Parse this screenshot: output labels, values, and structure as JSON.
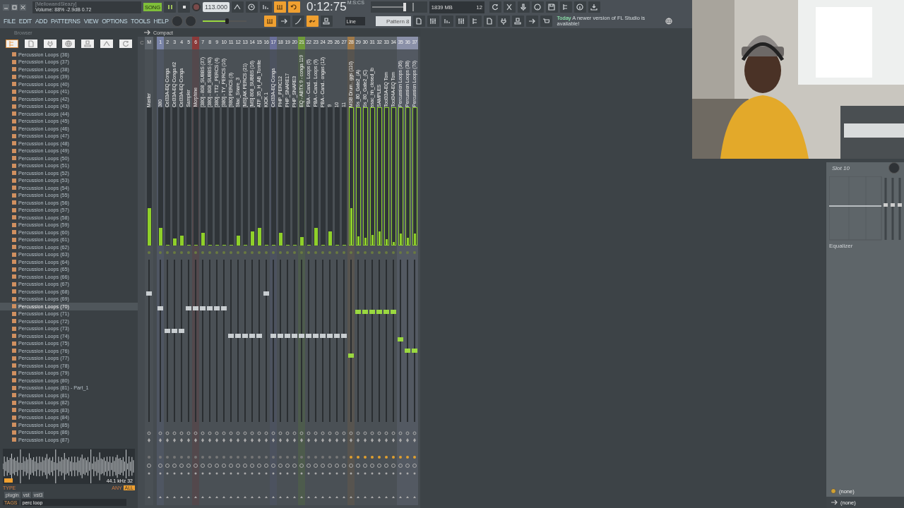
{
  "hint_panel": {
    "title": "[MellowandSleazy]",
    "readout": "Volume: 88%  -2.9dB  0.72"
  },
  "menu": [
    "FILE",
    "EDIT",
    "ADD",
    "PATTERNS",
    "VIEW",
    "OPTIONS",
    "TOOLS",
    "HELP"
  ],
  "transport": {
    "mode": "SONG",
    "playing": true,
    "recording": false,
    "tempo": "113.000"
  },
  "time": {
    "value": "0:12:75",
    "unit": "M:S:CS"
  },
  "monitor": {
    "memory": "1839 MB",
    "polyphony": "12"
  },
  "master_pitch": {
    "level": 0.55
  },
  "toggles_top": [
    {
      "on": false
    },
    {
      "on": false
    },
    {
      "on": false
    },
    {
      "on": true
    },
    {
      "on": true
    }
  ],
  "toggles_bottom": [
    {
      "on": true
    },
    {
      "on": false
    },
    {
      "on": false
    },
    {
      "on": true
    },
    {
      "on": false
    }
  ],
  "snap": "Line",
  "pattern": "Pattern 8",
  "news": {
    "label": "Today",
    "text": "A newer version of FL Studio is available!"
  },
  "browser": {
    "title": "Browser",
    "items": [
      {
        "label": "Percussion Loops (36)",
        "selected": false
      },
      {
        "label": "Percussion Loops (37)",
        "selected": false
      },
      {
        "label": "Percussion Loops (38)",
        "selected": false
      },
      {
        "label": "Percussion Loops (39)",
        "selected": false
      },
      {
        "label": "Percussion Loops (40)",
        "selected": false
      },
      {
        "label": "Percussion Loops (41)",
        "selected": false
      },
      {
        "label": "Percussion Loops (42)",
        "selected": false
      },
      {
        "label": "Percussion Loops (43)",
        "selected": false
      },
      {
        "label": "Percussion Loops (44)",
        "selected": false
      },
      {
        "label": "Percussion Loops (45)",
        "selected": false
      },
      {
        "label": "Percussion Loops (46)",
        "selected": false
      },
      {
        "label": "Percussion Loops (47)",
        "selected": false
      },
      {
        "label": "Percussion Loops (48)",
        "selected": false
      },
      {
        "label": "Percussion Loops (49)",
        "selected": false
      },
      {
        "label": "Percussion Loops (50)",
        "selected": false
      },
      {
        "label": "Percussion Loops (51)",
        "selected": false
      },
      {
        "label": "Percussion Loops (52)",
        "selected": false
      },
      {
        "label": "Percussion Loops (53)",
        "selected": false
      },
      {
        "label": "Percussion Loops (54)",
        "selected": false
      },
      {
        "label": "Percussion Loops (55)",
        "selected": false
      },
      {
        "label": "Percussion Loops (56)",
        "selected": false
      },
      {
        "label": "Percussion Loops (57)",
        "selected": false
      },
      {
        "label": "Percussion Loops (58)",
        "selected": false
      },
      {
        "label": "Percussion Loops (59)",
        "selected": false
      },
      {
        "label": "Percussion Loops (60)",
        "selected": false
      },
      {
        "label": "Percussion Loops (61)",
        "selected": false
      },
      {
        "label": "Percussion Loops (62)",
        "selected": false
      },
      {
        "label": "Percussion Loops (63)",
        "selected": false
      },
      {
        "label": "Percussion Loops (64)",
        "selected": false
      },
      {
        "label": "Percussion Loops (65)",
        "selected": false
      },
      {
        "label": "Percussion Loops (66)",
        "selected": false
      },
      {
        "label": "Percussion Loops (67)",
        "selected": false
      },
      {
        "label": "Percussion Loops (68)",
        "selected": false
      },
      {
        "label": "Percussion Loops (69)",
        "selected": false
      },
      {
        "label": "Percussion Loops (70)",
        "selected": true
      },
      {
        "label": "Percussion Loops (71)",
        "selected": false
      },
      {
        "label": "Percussion Loops (72)",
        "selected": false
      },
      {
        "label": "Percussion Loops (73)",
        "selected": false
      },
      {
        "label": "Percussion Loops (74)",
        "selected": false
      },
      {
        "label": "Percussion Loops (75)",
        "selected": false
      },
      {
        "label": "Percussion Loops (76)",
        "selected": false
      },
      {
        "label": "Percussion Loops (77)",
        "selected": false
      },
      {
        "label": "Percussion Loops (78)",
        "selected": false
      },
      {
        "label": "Percussion Loops (79)",
        "selected": false
      },
      {
        "label": "Percussion Loops (80)",
        "selected": false
      },
      {
        "label": "Percussion Loops (81) - Part_1",
        "selected": false
      },
      {
        "label": "Percussion Loops (81)",
        "selected": false
      },
      {
        "label": "Percussion Loops (82)",
        "selected": false
      },
      {
        "label": "Percussion Loops (83)",
        "selected": false
      },
      {
        "label": "Percussion Loops (84)",
        "selected": false
      },
      {
        "label": "Percussion Loops (85)",
        "selected": false
      },
      {
        "label": "Percussion Loops (86)",
        "selected": false
      },
      {
        "label": "Percussion Loops (87)",
        "selected": false
      }
    ]
  },
  "preview": {
    "info": "44.1 kHz 32",
    "type_label": "TYPE",
    "filter_any": "ANY",
    "filter_all": "ALL",
    "tags": [
      "plugin",
      "vst",
      "vst3"
    ],
    "search_label": "TAGS",
    "search_value": "perc loop"
  },
  "mixer": {
    "view": "Compact",
    "current": "C",
    "tracks": [
      {
        "number": "M",
        "name": "Master",
        "color": "#5d646b",
        "selected": false,
        "meter": {
          "level": 0.27
        },
        "fader": {
          "level": 0.79
        }
      },
      {
        "number": "1",
        "name": "380",
        "color": "#7a84a8",
        "selected": false,
        "meter": {
          "level": 0.13
        },
        "fader": {
          "level": 0.7
        }
      },
      {
        "number": "2",
        "name": "Cel33A-EQ Conga",
        "color": "#5d646b",
        "selected": false,
        "meter": {
          "level": 0
        },
        "fader": {
          "level": 0.56
        }
      },
      {
        "number": "3",
        "name": "Cel33A-EQ Conga #2",
        "color": "#5d646b",
        "selected": false,
        "meter": {
          "level": 0.05
        },
        "fader": {
          "level": 0.56
        }
      },
      {
        "number": "4",
        "name": "Cel33A-EQ Conga",
        "color": "#5d646b",
        "selected": false,
        "meter": {
          "level": 0.07
        },
        "fader": {
          "level": 0.56
        }
      },
      {
        "number": "5",
        "name": "Sampler",
        "color": "#5d646b",
        "selected": false,
        "meter": {
          "level": 0
        },
        "fader": {
          "level": 0.7
        }
      },
      {
        "number": "6",
        "name": "Morphine",
        "color": "#8a3a3a",
        "selected": false,
        "meter": {
          "level": 0
        },
        "fader": {
          "level": 0.7
        }
      },
      {
        "number": "7",
        "name": "[380] - 808_SUBBS (37)",
        "color": "#5d646b",
        "selected": false,
        "meter": {
          "level": 0.09
        },
        "fader": {
          "level": 0.7
        }
      },
      {
        "number": "8",
        "name": "[380] - 808_SUBBS (40)",
        "color": "#5d646b",
        "selected": false,
        "meter": {
          "level": 0
        },
        "fader": {
          "level": 0.7
        }
      },
      {
        "number": "9",
        "name": "[380] - TT2 _PERCS (4)",
        "color": "#5d646b",
        "selected": false,
        "meter": {
          "level": 0
        },
        "fader": {
          "level": 0.7
        }
      },
      {
        "number": "10",
        "name": "[380] - TY_PERCS (10)",
        "color": "#5d646b",
        "selected": false,
        "meter": {
          "level": 0
        },
        "fader": {
          "level": 0.7
        }
      },
      {
        "number": "11",
        "name": "[980] PERCS (3)",
        "color": "#5d646b",
        "selected": false,
        "meter": {
          "level": 0
        },
        "fader": {
          "level": 0.53
        }
      },
      {
        "number": "12",
        "name": "Stac_Snare_3",
        "color": "#5d646b",
        "selected": false,
        "meter": {
          "level": 0.07
        },
        "fader": {
          "level": 0.53
        }
      },
      {
        "number": "13",
        "name": "[MS] AK PERCS (21)",
        "color": "#5d646b",
        "selected": false,
        "meter": {
          "level": 0
        },
        "fader": {
          "level": 0.53
        }
      },
      {
        "number": "14",
        "name": "[MS] 808_SUBBS (16)",
        "color": "#5d646b",
        "selected": false,
        "meter": {
          "level": 0.1
        },
        "fader": {
          "level": 0.53
        }
      },
      {
        "number": "15",
        "name": "ATF_35_H_AB_Tomite",
        "color": "#5d646b",
        "selected": false,
        "meter": {
          "level": 0.13
        },
        "fader": {
          "level": 0.53
        }
      },
      {
        "number": "16",
        "name": "KICK 1",
        "color": "#5d646b",
        "selected": false,
        "meter": {
          "level": 0
        },
        "fader": {
          "level": 0.79
        }
      },
      {
        "number": "17",
        "name": "Cel33A-EQ Conga",
        "color": "#6a6f9a",
        "selected": false,
        "meter": {
          "level": 0
        },
        "fader": {
          "level": 0.53
        }
      },
      {
        "number": "18",
        "name": "PHP_PERC12",
        "color": "#5d646b",
        "selected": false,
        "meter": {
          "level": 0.09
        },
        "fader": {
          "level": 0.53
        }
      },
      {
        "number": "19",
        "name": "PHP_SNARE17",
        "color": "#5d646b",
        "selected": false,
        "meter": {
          "level": 0
        },
        "fader": {
          "level": 0.53
        }
      },
      {
        "number": "20",
        "name": "PHP_SNARE3",
        "color": "#5d646b",
        "selected": false,
        "meter": {
          "level": 0
        },
        "fader": {
          "level": 0.53
        }
      },
      {
        "number": "21",
        "name": "EQ - ABTX 9 - conga 119",
        "color": "#6f9a3a",
        "selected": false,
        "meter": {
          "level": 0.06
        },
        "fader": {
          "level": 0.53
        }
      },
      {
        "number": "22",
        "name": "PBA - Cand.. Loops (6)",
        "color": "#5d646b",
        "selected": false,
        "meter": {
          "level": 0
        },
        "fader": {
          "level": 0.53
        }
      },
      {
        "number": "23",
        "name": "PBA - Cand.. Loops (9)",
        "color": "#5d646b",
        "selected": false,
        "meter": {
          "level": 0.13
        },
        "fader": {
          "level": 0.53
        }
      },
      {
        "number": "24",
        "name": "PBA - Cand.. ongas (12)",
        "color": "#5d646b",
        "selected": false,
        "meter": {
          "level": 0
        },
        "fader": {
          "level": 0.53
        }
      },
      {
        "number": "25",
        "name": "9",
        "color": "#5d646b",
        "selected": false,
        "meter": {
          "level": 0.1
        },
        "fader": {
          "level": 0.53
        }
      },
      {
        "number": "26",
        "name": "10",
        "color": "#5d646b",
        "selected": false,
        "meter": {
          "level": 0
        },
        "fader": {
          "level": 0.53
        }
      },
      {
        "number": "27",
        "name": "11",
        "color": "#5d646b",
        "selected": false,
        "meter": {
          "level": 0
        },
        "fader": {
          "level": 0.53
        }
      },
      {
        "number": "28",
        "name": "MSB Drum.. ggs (110)",
        "color": "#a07a4a",
        "selected": true,
        "meter": {
          "level": 0.27
        },
        "fader": {
          "level": 0.41
        }
      },
      {
        "number": "29",
        "name": "Ss_80_Gate2_(A)",
        "color": "#5d646b",
        "selected": true,
        "meter": {
          "level": 0.06
        },
        "fader": {
          "level": 0.68
        }
      },
      {
        "number": "30",
        "name": "Ss_80_Gate2_(C)",
        "color": "#5d646b",
        "selected": true,
        "meter": {
          "level": 0.05
        },
        "fader": {
          "level": 0.68
        }
      },
      {
        "number": "31",
        "name": "ssac_hh_closed_lb",
        "color": "#5d646b",
        "selected": true,
        "meter": {
          "level": 0.07
        },
        "fader": {
          "level": 0.68
        }
      },
      {
        "number": "32",
        "name": "SAMPLES",
        "color": "#5d646b",
        "selected": true,
        "meter": {
          "level": 0.1
        },
        "fader": {
          "level": 0.68
        }
      },
      {
        "number": "33",
        "name": "Tool33A-EQ Tom",
        "color": "#5d646b",
        "selected": true,
        "meter": {
          "level": 0.04
        },
        "fader": {
          "level": 0.68
        }
      },
      {
        "number": "34",
        "name": "Tool34A-EQ Tom",
        "color": "#5d646b",
        "selected": true,
        "meter": {
          "level": 0.02
        },
        "fader": {
          "level": 0.68
        }
      },
      {
        "number": "35",
        "name": "Percussion Loops (36)",
        "color": "#8a90a8",
        "selected": true,
        "meter": {
          "level": 0.08
        },
        "fader": {
          "level": 0.51
        }
      },
      {
        "number": "36",
        "name": "Percussion Loops (38)",
        "color": "#8a90a8",
        "selected": true,
        "meter": {
          "level": 0.05
        },
        "fader": {
          "level": 0.44
        }
      },
      {
        "number": "37",
        "name": "Percussion Loops (70)",
        "color": "#8a90a8",
        "selected": true,
        "meter": {
          "level": 0.08
        },
        "fader": {
          "level": 0.44
        }
      }
    ]
  },
  "inserts": {
    "slot": "Slot 10",
    "plugin": "Equalizer",
    "input": "(none)",
    "output": "(none)"
  }
}
